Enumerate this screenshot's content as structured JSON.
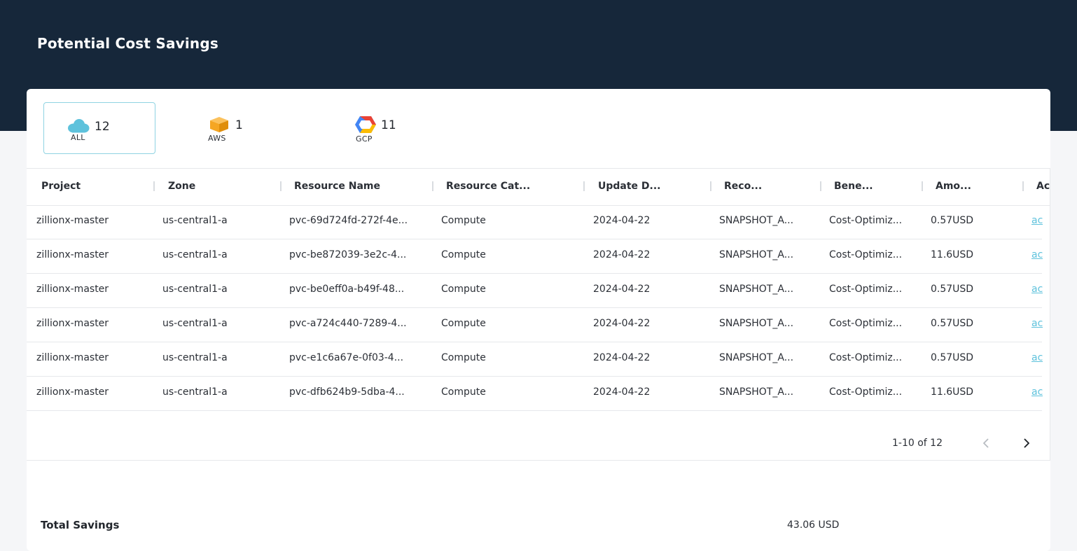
{
  "page": {
    "title": "Potential Cost Savings"
  },
  "providers": [
    {
      "key": "all",
      "label": "ALL",
      "count": "12",
      "icon": "cloud-icon",
      "active": true
    },
    {
      "key": "aws",
      "label": "AWS",
      "count": "1",
      "icon": "aws-box-icon",
      "active": false
    },
    {
      "key": "gcp",
      "label": "GCP",
      "count": "11",
      "icon": "gcp-hexagon-icon",
      "active": false
    }
  ],
  "table": {
    "columns": [
      "Project",
      "Zone",
      "Resource Name",
      "Resource Cat...",
      "Update D...",
      "Reco...",
      "Bene...",
      "Amo...",
      "Ac"
    ],
    "rows": [
      {
        "project": "zillionx-master",
        "zone": "us-central1-a",
        "resource_name": "pvc-69d724fd-272f-4e...",
        "category": "Compute",
        "update_date": "2024-04-22",
        "recommendation": "SNAPSHOT_A...",
        "benefit": "Cost-Optimiz...",
        "amount": "0.57USD",
        "action": "ac"
      },
      {
        "project": "zillionx-master",
        "zone": "us-central1-a",
        "resource_name": "pvc-be872039-3e2c-4...",
        "category": "Compute",
        "update_date": "2024-04-22",
        "recommendation": "SNAPSHOT_A...",
        "benefit": "Cost-Optimiz...",
        "amount": "11.6USD",
        "action": "ac"
      },
      {
        "project": "zillionx-master",
        "zone": "us-central1-a",
        "resource_name": "pvc-be0eff0a-b49f-48...",
        "category": "Compute",
        "update_date": "2024-04-22",
        "recommendation": "SNAPSHOT_A...",
        "benefit": "Cost-Optimiz...",
        "amount": "0.57USD",
        "action": "ac"
      },
      {
        "project": "zillionx-master",
        "zone": "us-central1-a",
        "resource_name": "pvc-a724c440-7289-4...",
        "category": "Compute",
        "update_date": "2024-04-22",
        "recommendation": "SNAPSHOT_A...",
        "benefit": "Cost-Optimiz...",
        "amount": "0.57USD",
        "action": "ac"
      },
      {
        "project": "zillionx-master",
        "zone": "us-central1-a",
        "resource_name": "pvc-e1c6a67e-0f03-4...",
        "category": "Compute",
        "update_date": "2024-04-22",
        "recommendation": "SNAPSHOT_A...",
        "benefit": "Cost-Optimiz...",
        "amount": "0.57USD",
        "action": "ac"
      },
      {
        "project": "zillionx-master",
        "zone": "us-central1-a",
        "resource_name": "pvc-dfb624b9-5dba-4...",
        "category": "Compute",
        "update_date": "2024-04-22",
        "recommendation": "SNAPSHOT_A...",
        "benefit": "Cost-Optimiz...",
        "amount": "11.6USD",
        "action": "ac"
      }
    ]
  },
  "pagination": {
    "summary": "1-10 of 12",
    "prev_icon": "chevron-left-icon",
    "next_icon": "chevron-right-icon"
  },
  "totals": {
    "label": "Total Savings",
    "value": "43.06 USD"
  },
  "colors": {
    "header_bg": "#16273a",
    "accent": "#5ec2dc",
    "active_border": "#8fd3e2",
    "aws": "#f5a623"
  }
}
